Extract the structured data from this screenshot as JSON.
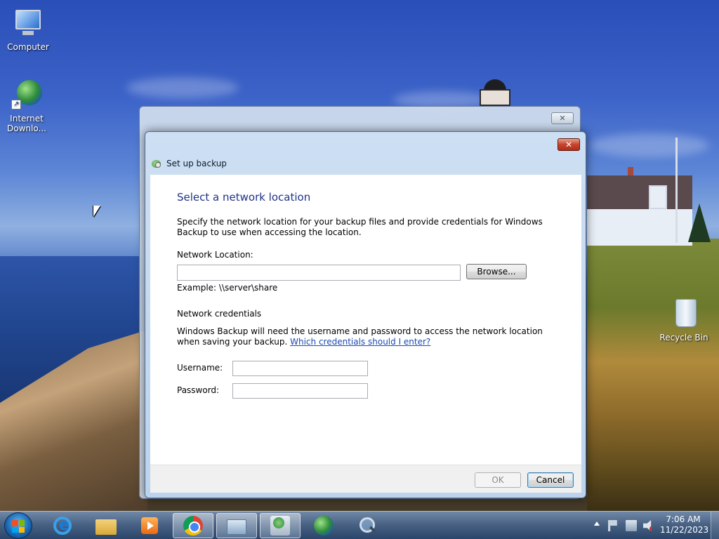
{
  "desktop": {
    "icons": [
      {
        "label": "Computer"
      },
      {
        "label": "Internet Downlo..."
      },
      {
        "label": "Recycle Bin"
      }
    ]
  },
  "dialog": {
    "title": "Set up backup",
    "close_symbol": "✕",
    "heading": "Select a network location",
    "intro": "Specify the network location for your backup files and provide credentials for Windows Backup to use when accessing the location.",
    "network_location_label": "Network Location:",
    "network_location_value": "",
    "browse_label": "Browse...",
    "example": "Example: \\\\server\\share",
    "credentials_heading": "Network credentials",
    "credentials_text": "Windows Backup will need the username and password to access the network location when saving your backup.",
    "credentials_link": "Which credentials should I enter?",
    "username_label": "Username:",
    "username_value": "",
    "password_label": "Password:",
    "password_value": "",
    "ok_label": "OK",
    "cancel_label": "Cancel"
  },
  "back_window": {
    "close_symbol": "✕"
  },
  "taskbar": {
    "pinned": [
      {
        "name": "internet-explorer-icon"
      },
      {
        "name": "file-explorer-icon"
      },
      {
        "name": "media-player-icon"
      },
      {
        "name": "chrome-icon"
      },
      {
        "name": "control-panel-icon"
      },
      {
        "name": "backup-restore-icon"
      },
      {
        "name": "internet-download-manager-icon"
      },
      {
        "name": "search-magnifier-icon"
      }
    ],
    "clock_time": "7:06 AM",
    "clock_date": "11/22/2023"
  },
  "colors": {
    "heading": "#1e3287",
    "link": "#1a4ab0",
    "close_red": "#c7432a"
  }
}
